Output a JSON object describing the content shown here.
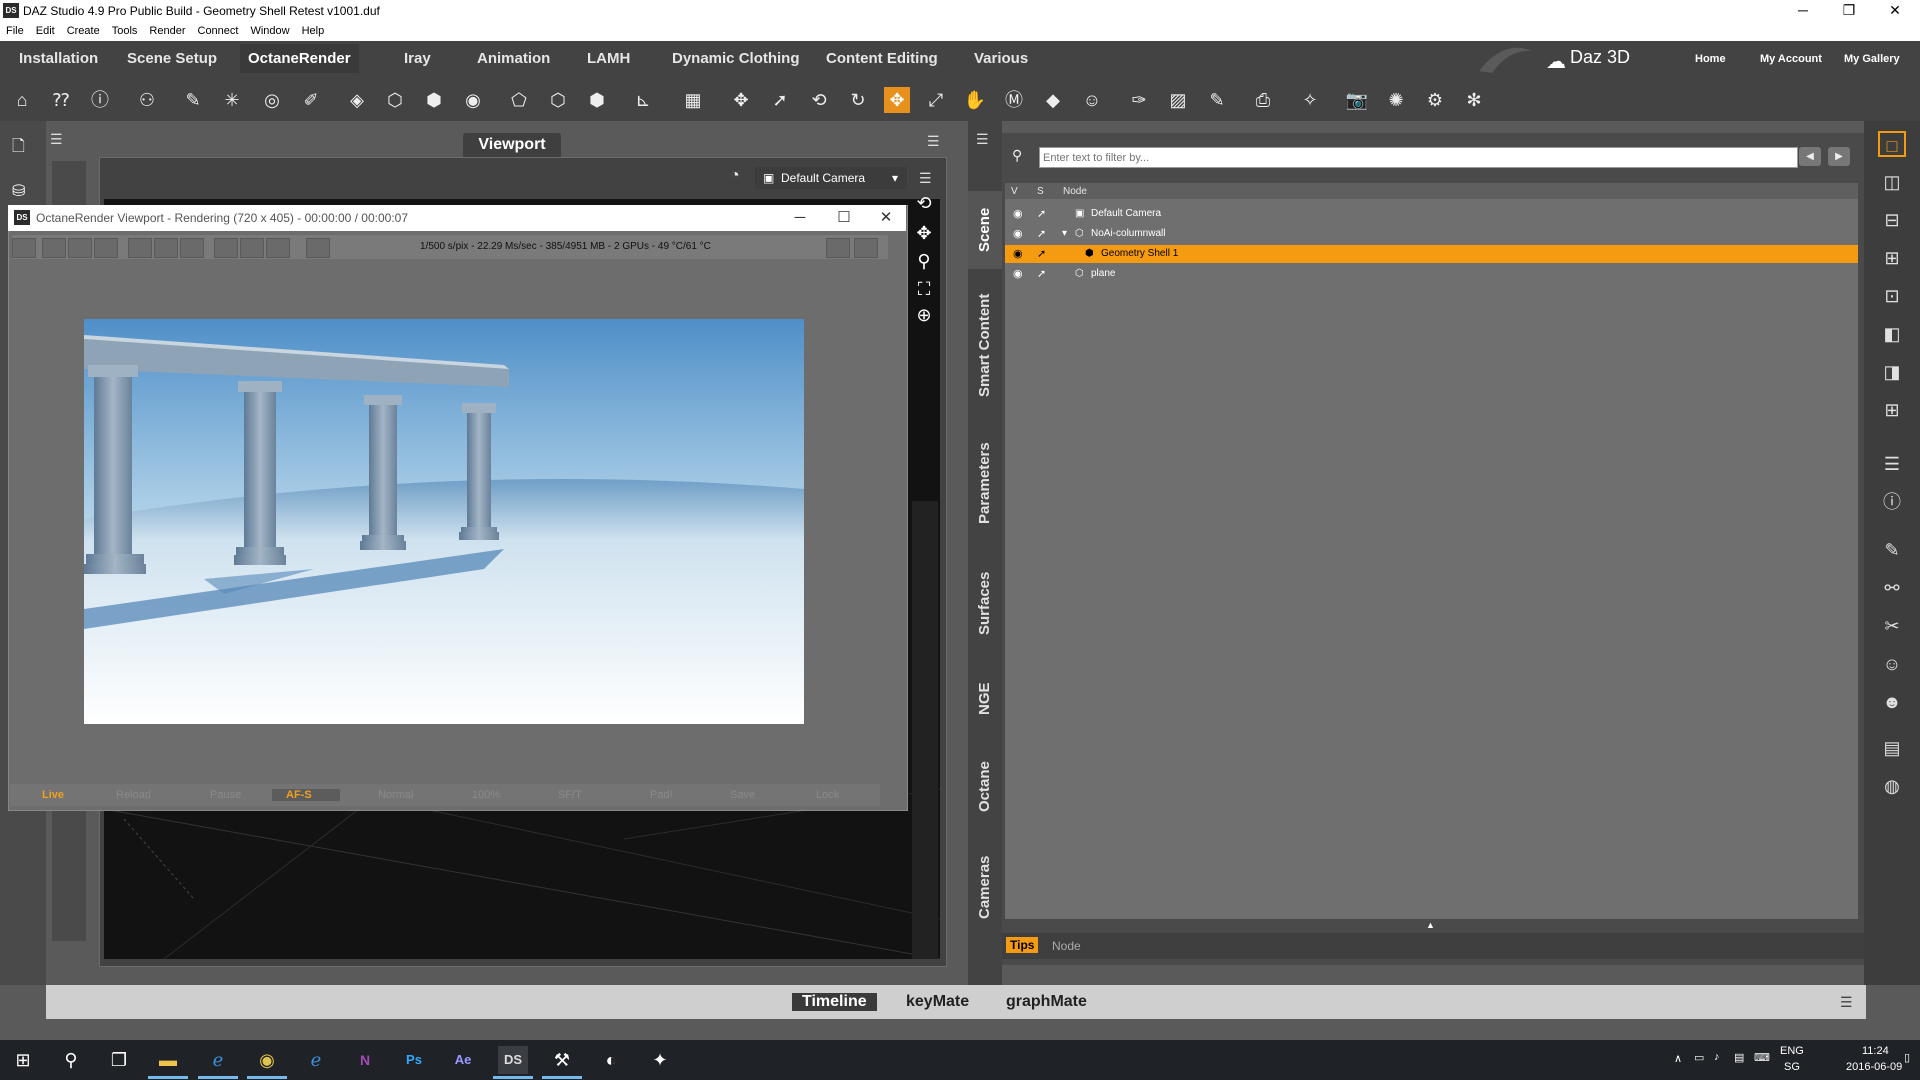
{
  "window": {
    "title": "DAZ Studio 4.9 Pro Public Build - Geometry Shell Retest v1001.duf",
    "app_badge": "DS",
    "controls": [
      "─",
      "❐",
      "✕"
    ]
  },
  "menu": [
    "File",
    "Edit",
    "Create",
    "Tools",
    "Render",
    "Connect",
    "Window",
    "Help"
  ],
  "tabs": [
    "Installation",
    "Scene Setup",
    "OctaneRender",
    "Iray",
    "Animation",
    "LAMH",
    "Dynamic Clothing",
    "Content Editing",
    "Various"
  ],
  "active_tab": "OctaneRender",
  "brand": "Daz 3D",
  "top_links": [
    "Home",
    "My Account",
    "My Gallery"
  ],
  "viewport": {
    "tab_label": "Viewport",
    "camera": "Default Camera"
  },
  "octane": {
    "badge": "DS",
    "title": "OctaneRender Viewport - Rendering (720 x 405) - 00:00:00 / 00:00:07",
    "stats": "1/500 s/pix - 22.29 Ms/sec - 385/4951 MB - 2 GPUs - 49 °C/61 °C",
    "bottom_buttons": [
      "Live",
      "Reload",
      "Pause",
      "AF-S",
      "Normal",
      "100%",
      "SF/T",
      "Pad!",
      "Save",
      "Lock"
    ],
    "active_button": "AF-S"
  },
  "vertical_tabs": [
    "Scene",
    "Smart Content",
    "Parameters",
    "Surfaces",
    "NGE",
    "Octane",
    "Cameras"
  ],
  "active_vertical_tab": "Scene",
  "scene": {
    "filter_placeholder": "Enter text to filter by...",
    "columns": [
      "V",
      "S",
      "Node"
    ],
    "nodes": [
      {
        "label": "Default Camera",
        "indent": 0,
        "selected": false,
        "expander": ""
      },
      {
        "label": "NoAi-columnwall",
        "indent": 0,
        "selected": false,
        "expander": "▾"
      },
      {
        "label": "Geometry Shell 1",
        "indent": 1,
        "selected": true,
        "expander": ""
      },
      {
        "label": "plane",
        "indent": 0,
        "selected": false,
        "expander": ""
      }
    ]
  },
  "tips": {
    "tips_label": "Tips",
    "node_label": "Node"
  },
  "timeline_tabs": [
    "Timeline",
    "keyMate",
    "graphMate"
  ],
  "active_timeline_tab": "Timeline",
  "taskbar": {
    "lang": "ENG",
    "region": "SG",
    "time": "11:24",
    "date": "2016-06-09"
  },
  "colors": {
    "accent": "#f49b12",
    "panel": "#434343",
    "selection": "#f49b12"
  }
}
